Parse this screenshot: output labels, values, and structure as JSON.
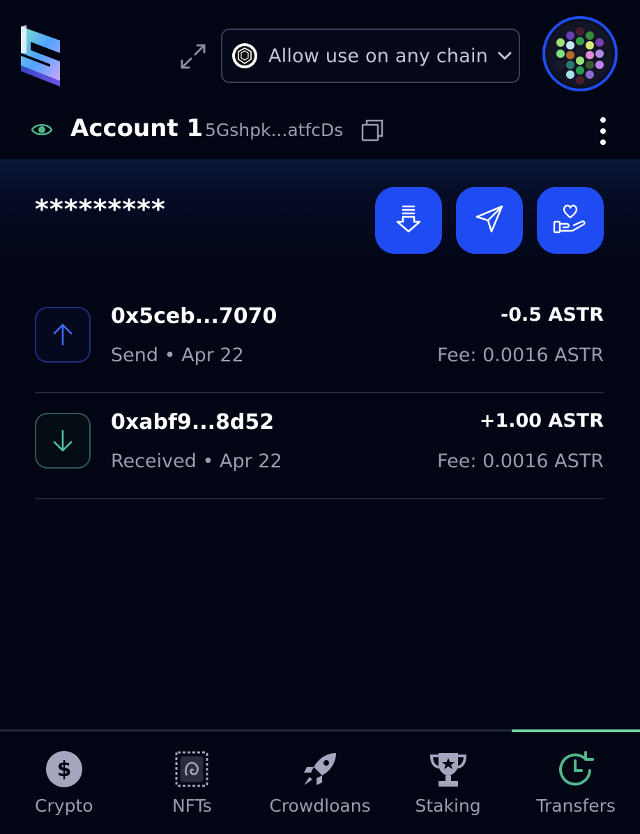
{
  "header": {
    "chain_selector": {
      "label": "Allow use on any chain",
      "icon": "chain-cube-icon"
    },
    "avatar": {
      "icon": "identicon"
    }
  },
  "account": {
    "name": "Account 1",
    "address": "5Gshpk...atfcDs"
  },
  "balance": {
    "value": "*********"
  },
  "actions": [
    {
      "name": "receive-button",
      "icon": "download-arrow-icon"
    },
    {
      "name": "send-button",
      "icon": "paper-plane-icon"
    },
    {
      "name": "donate-button",
      "icon": "heart-hand-icon"
    }
  ],
  "transactions": [
    {
      "hash": "0x5ceb...7070",
      "type": "Send",
      "date": "Apr 22",
      "amount": "-0.5 ASTR",
      "fee": "Fee: 0.0016 ASTR",
      "direction": "out"
    },
    {
      "hash": "0xabf9...8d52",
      "type": "Received",
      "date": "Apr 22",
      "amount": "+1.00 ASTR",
      "fee": "Fee: 0.0016 ASTR",
      "direction": "in"
    }
  ],
  "nav": [
    {
      "label": "Crypto",
      "icon": "dollar-coin-icon"
    },
    {
      "label": "NFTs",
      "icon": "nft-stamp-icon"
    },
    {
      "label": "Crowdloans",
      "icon": "rocket-icon"
    },
    {
      "label": "Staking",
      "icon": "trophy-icon"
    },
    {
      "label": "Transfers",
      "icon": "clock-history-icon",
      "active": true
    }
  ],
  "colors": {
    "background": "#020514",
    "accent": "#1f4cf2",
    "active_tab": "#6ed6a5",
    "muted_text": "#9a9db0"
  }
}
